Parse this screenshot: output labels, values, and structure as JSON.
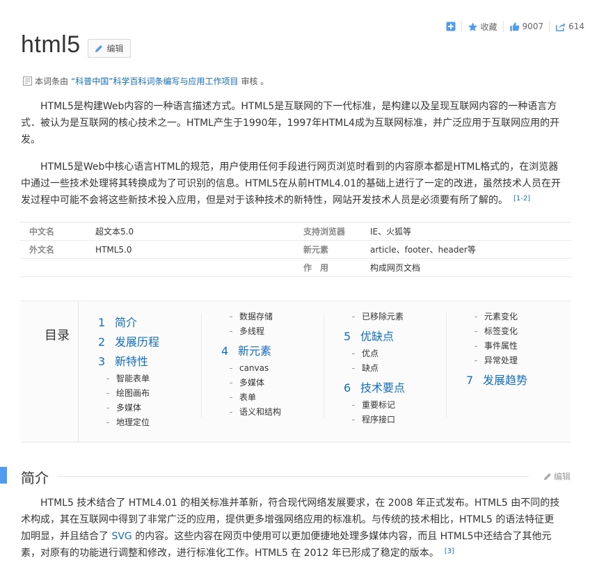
{
  "toolbar": {
    "add_icon": "plus-square-icon",
    "favorite_label": "收藏",
    "like_count": "9007",
    "share_count": "614"
  },
  "title": "html5",
  "edit_label": "编辑",
  "review": {
    "prefix": "本词条由",
    "org": "“科普中国”科学百科词条编写与应用工作项目",
    "suffix": "审核 。"
  },
  "intro": {
    "p1": "HTML5是构建Web内容的一种语言描述方式。HTML5是互联网的下一代标准，是构建以及呈现互联网内容的一种语言方式．被认为是互联网的核心技术之一。HTML产生于1990年，1997年HTML4成为互联网标准，并广泛应用于互联网应用的开发。",
    "p2": "HTML5是Web中核心语言HTML的规范，用户使用任何手段进行网页浏览时看到的内容原本都是HTML格式的，在浏览器中通过一些技术处理将其转换成为了可识别的信息。HTML5在从前HTML4.01的基础上进行了一定的改进，虽然技术人员在开发过程中可能不会将这些新技术投入应用，但是对于该种技术的新特性，网站开发技术人员是必须要有所了解的。",
    "p2_ref": "[1-2]"
  },
  "basic_info": {
    "left": [
      {
        "label": "中文名",
        "value": "超文本5.0"
      },
      {
        "label": "外文名",
        "value": "HTML5.0"
      }
    ],
    "right": [
      {
        "label": "支持浏览器",
        "value": "IE、火狐等"
      },
      {
        "label": "新元素",
        "value": "article、footer、header等"
      },
      {
        "label": "作　用",
        "value": "构成网页文档"
      }
    ]
  },
  "toc": {
    "heading": "目录",
    "col1": [
      {
        "num": "1",
        "title": "简介"
      },
      {
        "num": "2",
        "title": "发展历程"
      },
      {
        "num": "3",
        "title": "新特性"
      }
    ],
    "col1_sub": [
      "智能表单",
      "绘图画布",
      "多媒体",
      "地理定位"
    ],
    "col2_pre": [
      "数据存储",
      "多线程"
    ],
    "col2": {
      "num": "4",
      "title": "新元素"
    },
    "col2_sub": [
      "canvas",
      "多媒体",
      "表单",
      "语义和结构"
    ],
    "col3_pre": [
      "已移除元素"
    ],
    "col3_a": {
      "num": "5",
      "title": "优缺点"
    },
    "col3_a_sub": [
      "优点",
      "缺点"
    ],
    "col3_b": {
      "num": "6",
      "title": "技术要点"
    },
    "col3_b_sub": [
      "重要标记",
      "程序接口"
    ],
    "col4_pre": [
      "元素变化",
      "标签变化",
      "事件属性",
      "异常处理"
    ],
    "col4": {
      "num": "7",
      "title": "发展趋势"
    }
  },
  "section": {
    "title": "简介",
    "edit_label": "编辑",
    "text_a": "HTML5 技术结合了 HTML4.01 的相关标准并革新，符合现代网络发展要求，在 2008 年正式发布。HTML5 由不同的技术构成，其在互联网中得到了非常广泛的应用，提供更多增强网络应用的标准机。与传统的技术相比，HTML5 的语法特征更加明显，并且结合了 ",
    "svg_link": "SVG",
    "text_b": " 的内容。这些内容在网页中使用可以更加便捷地处理多媒体内容，而且 HTML5中还结合了其他元素，对原有的功能进行调整和修改，进行标准化工作。HTML5 在 2012 年已形成了稳定的版本。",
    "ref": "[3]"
  },
  "colors": {
    "accent": "#4f9cee",
    "link": "#136ec2"
  }
}
